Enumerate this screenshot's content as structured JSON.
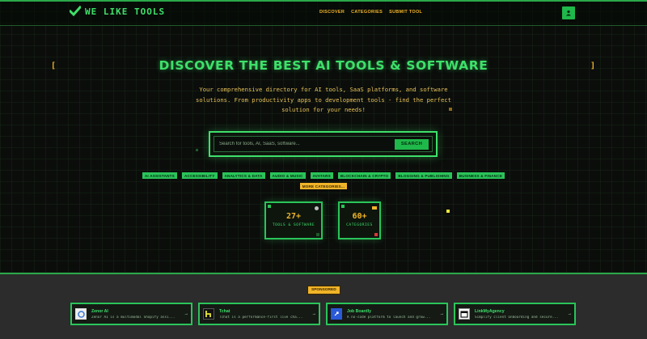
{
  "app": {
    "name": "WE LIKE TOOLS"
  },
  "nav": {
    "items": [
      "DISCOVER",
      "CATEGORIES",
      "SUBMIT TOOL"
    ]
  },
  "hero": {
    "bracket_left": "[",
    "bracket_right": "]",
    "title": "DISCOVER THE BEST AI TOOLS & SOFTWARE",
    "subtitle": "Your comprehensive directory for AI tools, SaaS platforms, and software solutions. From productivity apps to development tools - find the perfect solution for your needs!"
  },
  "search": {
    "placeholder": "Search for tools, AI, SaaS, software...",
    "button_label": "SEARCH"
  },
  "tags": [
    "AI ASSISTANTS",
    "ACCESSIBILITY",
    "ANALYTICS & DATA",
    "AUDIO & MUSIC",
    "AVATARS",
    "BLOCKCHAIN & CRYPTO",
    "BLOGGING & PUBLISHING",
    "BUSINESS & FINANCE",
    "MORE CATEGORIES..."
  ],
  "stats": [
    {
      "value": "27+",
      "label": "TOOLS & SOFTWARE"
    },
    {
      "value": "60+",
      "label": "CATEGORIES"
    }
  ],
  "sponsored": {
    "badge": "SPONSORED",
    "cards": [
      {
        "name": "Zenor AI",
        "description": "Zenor AI is a multimodal Shopify assi...",
        "icon": "zenor-logo-icon",
        "arrow": "→"
      },
      {
        "name": "Tchat",
        "description": "Tchat is a performance-first live cha...",
        "icon": "tchat-logo-icon",
        "arrow": "→"
      },
      {
        "name": "Job Boardly",
        "description": "A no-code platform to launch and grow...",
        "icon": "jobboardly-logo-icon",
        "arrow": "→"
      },
      {
        "name": "LinkMyAgency",
        "description": "Simplify client onboarding and secure...",
        "icon": "linkmyagency-logo-icon",
        "arrow": "→"
      }
    ]
  },
  "colors": {
    "primary_green": "#3ee06a",
    "accent_yellow": "#f0b429",
    "background": "#0b0d0b"
  }
}
